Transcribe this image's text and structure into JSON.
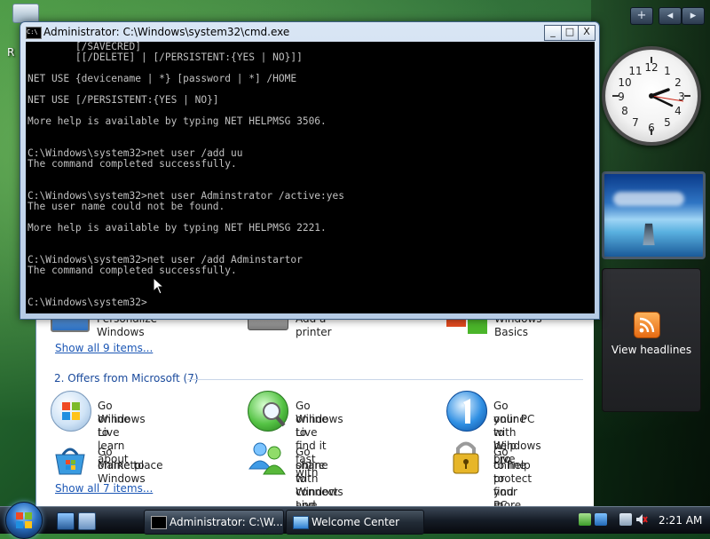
{
  "desktop": {
    "partial_label": "R"
  },
  "cmd": {
    "title": "Administrator: C:\\Windows\\system32\\cmd.exe",
    "icon_text": "C:\\",
    "controls": {
      "minimize": "_",
      "maximize": "□",
      "close": "X"
    },
    "lines": [
      "        [/SAVECRED]",
      "        [[/DELETE] | [/PERSISTENT:{YES | NO}]]",
      "",
      "NET USE {devicename | *} [password | *] /HOME",
      "",
      "NET USE [/PERSISTENT:{YES | NO}]",
      "",
      "More help is available by typing NET HELPMSG 3506.",
      "",
      "",
      "C:\\Windows\\system32>net user /add uu",
      "The command completed successfully.",
      "",
      "",
      "C:\\Windows\\system32>net user Adminstrator /active:yes",
      "The user name could not be found.",
      "",
      "More help is available by typing NET HELPMSG 2221.",
      "",
      "",
      "C:\\Windows\\system32>net user /add Adminstartor",
      "The command completed successfully.",
      "",
      "",
      "C:\\Windows\\system32>"
    ]
  },
  "welcome": {
    "top_items": [
      {
        "label": "Personalize Windows",
        "icon": "monitor-icon"
      },
      {
        "label": "Add a printer",
        "icon": "printer-icon"
      },
      {
        "label": "Windows Basics",
        "icon": "windows-basics-icon"
      }
    ],
    "show_all_1": "Show all 9 items...",
    "section_title": "2. Offers from Microsoft (7)",
    "offers": [
      {
        "line1": "Go online to learn about",
        "line2": "Windows Live",
        "icon": "windows-live-icon"
      },
      {
        "line1": "Go online to find it fast with",
        "line2": "Windows Live",
        "icon": "search-globe-icon"
      },
      {
        "line1": "Go online to help pro",
        "line2": "your PC with Windows Live",
        "icon": "onecare-icon"
      },
      {
        "line1": "Go online to Windows",
        "line2": "Marketplace",
        "icon": "marketplace-icon"
      },
      {
        "line1": "Go online to connect and",
        "line2": "share with Windows Live",
        "icon": "messenger-icon"
      },
      {
        "line1": "Go online to find more ways",
        "line2": "to help protect your PC",
        "icon": "padlock-icon"
      }
    ],
    "show_all_2": "Show all 7 items..."
  },
  "sidebar": {
    "add_button": "+",
    "prev_button": "◂",
    "next_button": "▸",
    "feed_label": "View headlines",
    "clock_time": "2:21"
  },
  "taskbar": {
    "buttons": [
      {
        "label": "Administrator: C:\\W...",
        "icon": "cmd-icon"
      },
      {
        "label": "Welcome Center",
        "icon": "welcome-center-icon"
      }
    ],
    "clock": "2:21 AM"
  }
}
